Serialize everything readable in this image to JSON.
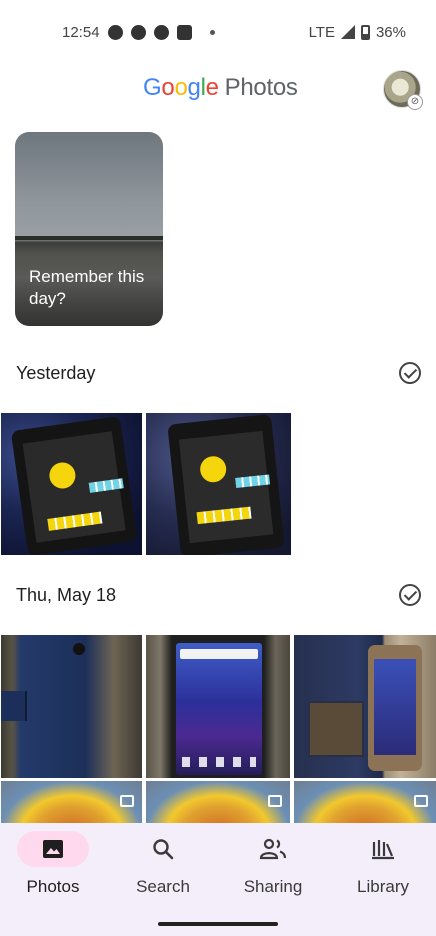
{
  "status_bar": {
    "time": "12:54",
    "network": "LTE",
    "battery": "36%",
    "icons": [
      "chat-icon",
      "whatsapp-icon",
      "phone-call-icon",
      "message-icon",
      "dot-icon",
      "signal-icon",
      "battery-icon"
    ]
  },
  "header": {
    "title_google": [
      "G",
      "o",
      "o",
      "g",
      "l",
      "e"
    ],
    "title_photos": "Photos",
    "avatar_icon": "account-avatar",
    "brand_colors": [
      "#4285F4",
      "#EA4335",
      "#FBBC05",
      "#4285F4",
      "#34A853",
      "#EA4335"
    ]
  },
  "memory": {
    "title": "Remember this day?"
  },
  "sections": [
    {
      "label": "Yesterday"
    },
    {
      "label": "Thu, May 18"
    }
  ],
  "bottom_nav": {
    "items": [
      {
        "label": "Photos",
        "icon": "photo-icon",
        "active": true
      },
      {
        "label": "Search",
        "icon": "search-icon",
        "active": false
      },
      {
        "label": "Sharing",
        "icon": "people-icon",
        "active": false
      },
      {
        "label": "Library",
        "icon": "library-icon",
        "active": false
      }
    ],
    "active_color": "#ffd9ee",
    "background": "#f4eefb"
  }
}
